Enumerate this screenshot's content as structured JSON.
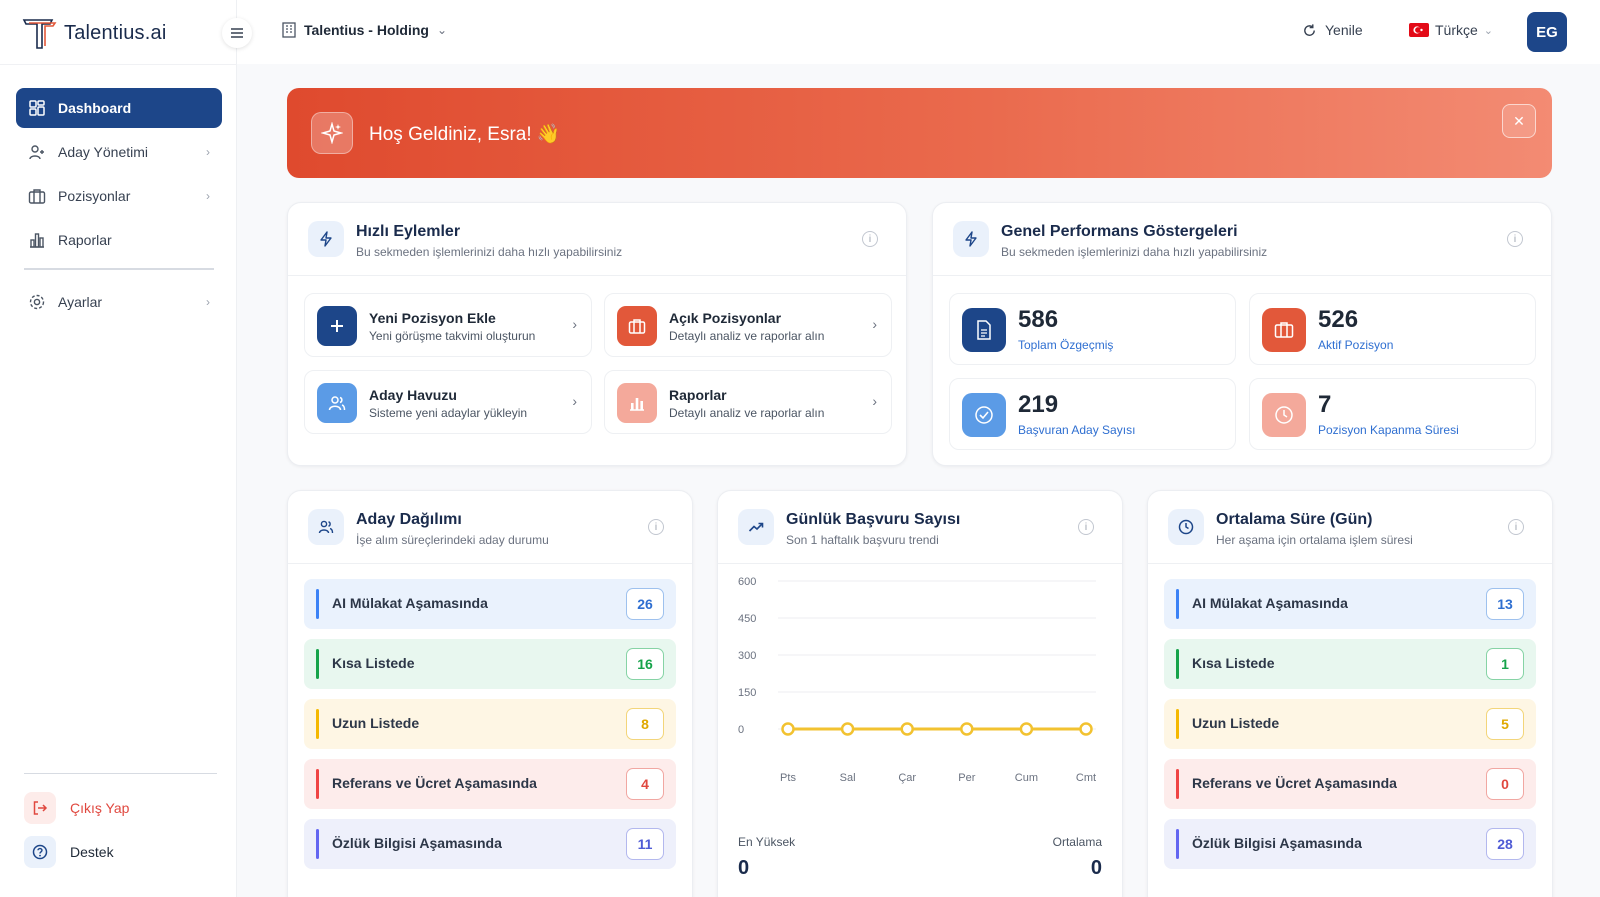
{
  "brand": {
    "name": "Talentius.ai"
  },
  "sidebar": {
    "items": [
      {
        "label": "Dashboard",
        "active": true,
        "icon": "grid-icon"
      },
      {
        "label": "Aday Yönetimi",
        "icon": "users-icon",
        "chevron": true
      },
      {
        "label": "Pozisyonlar",
        "icon": "briefcase-icon",
        "chevron": true
      },
      {
        "label": "Raporlar",
        "icon": "bar-chart-icon",
        "chevron": false
      }
    ],
    "settings": {
      "label": "Ayarlar",
      "icon": "gear-icon"
    },
    "logout": {
      "label": "Çıkış Yap",
      "icon": "logout-icon"
    },
    "support": {
      "label": "Destek",
      "icon": "help-icon"
    }
  },
  "topbar": {
    "org": "Talentius - Holding",
    "refresh": "Yenile",
    "language": "Türkçe",
    "avatar_initials": "EG"
  },
  "banner": {
    "text": "Hoş Geldiniz, Esra! 👋"
  },
  "quick_actions": {
    "title": "Hızlı Eylemler",
    "subtitle": "Bu sekmeden işlemlerinizi daha hızlı yapabilirsiniz",
    "items": [
      {
        "title": "Yeni Pozisyon Ekle",
        "subtitle": "Yeni görüşme takvimi oluşturun",
        "icon": "plus-icon",
        "color": "#1d4689"
      },
      {
        "title": "Açık Pozisyonlar",
        "subtitle": "Detaylı analiz ve raporlar alın",
        "icon": "briefcase-icon",
        "color": "#e2583a"
      },
      {
        "title": "Aday Havuzu",
        "subtitle": "Sisteme yeni adaylar yükleyin",
        "icon": "users-icon",
        "color": "#5b9be6"
      },
      {
        "title": "Raporlar",
        "subtitle": "Detaylı analiz ve raporlar alın",
        "icon": "bar-chart-icon",
        "color": "#f4a99b"
      }
    ]
  },
  "performance": {
    "title": "Genel Performans Göstergeleri",
    "subtitle": "Bu sekmeden işlemlerinizi daha hızlı yapabilirsiniz",
    "items": [
      {
        "value": "586",
        "label": "Toplam Özgeçmiş",
        "icon": "document-icon",
        "color": "#1d4689"
      },
      {
        "value": "526",
        "label": "Aktif Pozisyon",
        "icon": "briefcase-icon",
        "color": "#e2583a"
      },
      {
        "value": "219",
        "label": "Başvuran Aday Sayısı",
        "icon": "check-circle-icon",
        "color": "#5b9be6"
      },
      {
        "value": "7",
        "label": "Pozisyon Kapanma Süresi",
        "icon": "clock-icon",
        "color": "#f4a99b"
      }
    ]
  },
  "distribution": {
    "title": "Aday Dağılımı",
    "subtitle": "İşe alım süreçlerindeki aday durumu",
    "rows": [
      {
        "label": "AI Mülakat Aşamasında",
        "count": "26"
      },
      {
        "label": "Kısa Listede",
        "count": "16"
      },
      {
        "label": "Uzun Listede",
        "count": "8"
      },
      {
        "label": "Referans ve Ücret Aşamasında",
        "count": "4"
      },
      {
        "label": "Özlük Bilgisi Aşamasında",
        "count": "11"
      }
    ]
  },
  "daily": {
    "title": "Günlük Başvuru Sayısı",
    "subtitle": "Son 1 haftalık başvuru trendi",
    "max_label": "En Yüksek",
    "max_value": "0",
    "avg_label": "Ortalama",
    "avg_value": "0"
  },
  "average": {
    "title": "Ortalama Süre (Gün)",
    "subtitle": "Her aşama için ortalama işlem süresi",
    "rows": [
      {
        "label": "AI Mülakat Aşamasında",
        "count": "13"
      },
      {
        "label": "Kısa Listede",
        "count": "1"
      },
      {
        "label": "Uzun Listede",
        "count": "5"
      },
      {
        "label": "Referans ve Ücret Aşamasında",
        "count": "0"
      },
      {
        "label": "Özlük Bilgisi Aşamasında",
        "count": "28"
      }
    ]
  },
  "stage_colors": [
    {
      "bg": "#eaf2fd",
      "bar": "#3b82f6",
      "text": "#2f6fd1",
      "border": "#9ec1ee"
    },
    {
      "bg": "#e8f7ef",
      "bar": "#16a34a",
      "text": "#16a34a",
      "border": "#86d3a5"
    },
    {
      "bg": "#fef6e4",
      "bar": "#f5b800",
      "text": "#e0a800",
      "border": "#f3d57a"
    },
    {
      "bg": "#fdeceb",
      "bar": "#ef4444",
      "text": "#e0483f",
      "border": "#f1a7a2"
    },
    {
      "bg": "#eef0fb",
      "bar": "#6366f1",
      "text": "#4f5bd5",
      "border": "#b3b8ee"
    }
  ],
  "chart_data": {
    "type": "line",
    "categories": [
      "Pts",
      "Sal",
      "Çar",
      "Per",
      "Cum",
      "Cmt"
    ],
    "values": [
      0,
      0,
      0,
      0,
      0,
      0
    ],
    "ylim": [
      0,
      600
    ],
    "yticks": [
      "600",
      "450",
      "300",
      "150",
      "0"
    ],
    "grid": true,
    "color": "#f2c230"
  }
}
